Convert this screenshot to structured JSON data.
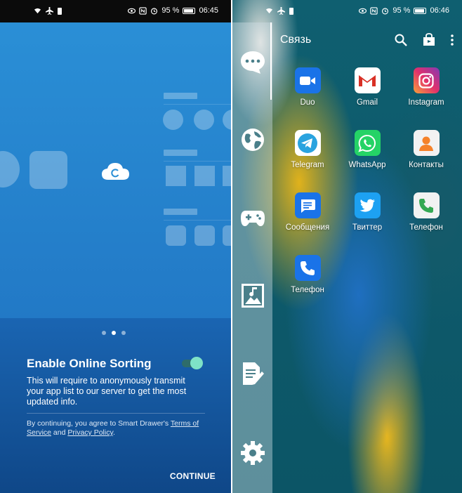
{
  "left": {
    "status": {
      "battery": "95 %",
      "time": "06:45"
    },
    "pager": {
      "pages": 3,
      "active": 2
    },
    "title": "Enable Online Sorting",
    "toggle_on": true,
    "description": "This will require to anonymously transmit your app list to our server to get the most updated info.",
    "legal_prefix": "By continuing, you agree to Smart Drawer's ",
    "terms_link": "Terms of Service",
    "legal_and": " and ",
    "privacy_link": "Privacy Policy",
    "legal_suffix": ".",
    "continue_label": "CONTINUE",
    "colors": {
      "hero": "#2a8fd6",
      "bottom": "#14539c",
      "toggle_knob": "#7ee2c7"
    }
  },
  "right": {
    "status": {
      "battery": "95 %",
      "time": "06:46"
    },
    "folder_title": "Связь",
    "sidebar_icons": [
      "chat-icon",
      "globe-icon",
      "gamepad-icon",
      "music-image-icon",
      "edit-document-icon",
      "settings-icon"
    ],
    "apps": [
      {
        "label": "Duo",
        "icon": "duo-icon",
        "color": "#1a73e8"
      },
      {
        "label": "Gmail",
        "icon": "gmail-icon",
        "color": "#ffffff"
      },
      {
        "label": "Instagram",
        "icon": "instagram-icon",
        "color": "#d6249f"
      },
      {
        "label": "Telegram",
        "icon": "telegram-icon",
        "color": "#ffffff"
      },
      {
        "label": "WhatsApp",
        "icon": "whatsapp-icon",
        "color": "#25d366"
      },
      {
        "label": "Контакты",
        "icon": "contacts-icon",
        "color": "#f2f2f2"
      },
      {
        "label": "Сообщения",
        "icon": "messages-icon",
        "color": "#1a73e8"
      },
      {
        "label": "Твиттер",
        "icon": "twitter-icon",
        "color": "#1da1f2"
      },
      {
        "label": "Телефон",
        "icon": "phone-icon",
        "color": "#f2f2f2"
      },
      {
        "label": "Телефон",
        "icon": "phone-icon",
        "color": "#1a73e8"
      }
    ]
  }
}
